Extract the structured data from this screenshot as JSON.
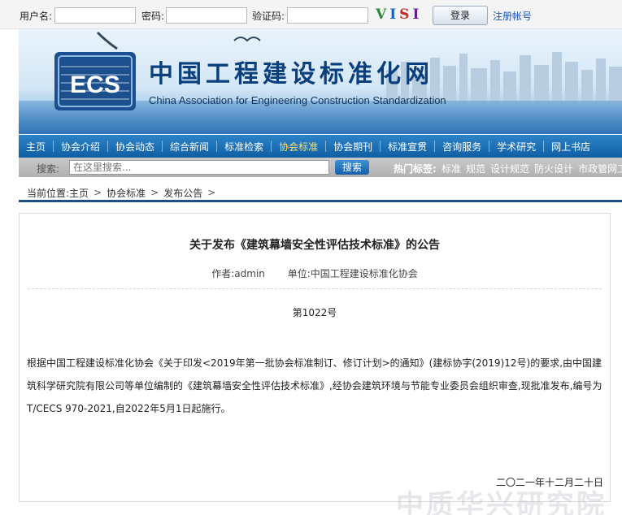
{
  "login": {
    "username_label": "用户名:",
    "password_label": "密码:",
    "captcha_label": "验证码:",
    "captcha_text": [
      "V",
      "I",
      "S",
      "I"
    ],
    "login_button": "登录",
    "register_link": "注册帐号"
  },
  "banner": {
    "logo_text": "ECS",
    "title_cn": "中国工程建设标准化网",
    "title_en": "China Association for Engineering Construction Standardization",
    "colors": {
      "brand_blue": "#0a3f7e",
      "accent": "#2d84c8"
    }
  },
  "nav": {
    "items": [
      {
        "label": "主页"
      },
      {
        "label": "协会介绍"
      },
      {
        "label": "协会动态"
      },
      {
        "label": "综合新闻"
      },
      {
        "label": "标准检索"
      },
      {
        "label": "协会标准",
        "active": true
      },
      {
        "label": "协会期刊"
      },
      {
        "label": "标准宣贯"
      },
      {
        "label": "咨询服务"
      },
      {
        "label": "学术研究"
      },
      {
        "label": "网上书店"
      }
    ],
    "active_color": "#ffe36e"
  },
  "search": {
    "label": "搜索:",
    "placeholder": "在这里搜索...",
    "button": "搜索",
    "hot_label": "热门标签:",
    "hot_tags": [
      "标准",
      "规范",
      "设计规范",
      "防火设计",
      "市政管网工"
    ]
  },
  "breadcrumb": {
    "prefix": "当前位置:",
    "items": [
      "主页",
      "协会标准",
      "发布公告"
    ]
  },
  "article": {
    "title": "关于发布《建筑幕墙安全性评估技术标准》的公告",
    "author": "作者:admin",
    "unit": "单位:中国工程建设标准化协会",
    "doc_number": "第1022号",
    "body": "根据中国工程建设标准化协会《关于印发<2019年第一批协会标准制订、修订计划>的通知》(建标协字(2019)12号)的要求,由中国建筑科学研究院有限公司等单位编制的《建筑幕墙安全性评估技术标准》,经协会建筑环境与节能专业委员会组织审查,现批准发布,编号为T/CECS 970-2021,自2022年5月1日起施行。",
    "date": "二〇二一年十二月二十日"
  },
  "watermark": "中质华兴研究院"
}
